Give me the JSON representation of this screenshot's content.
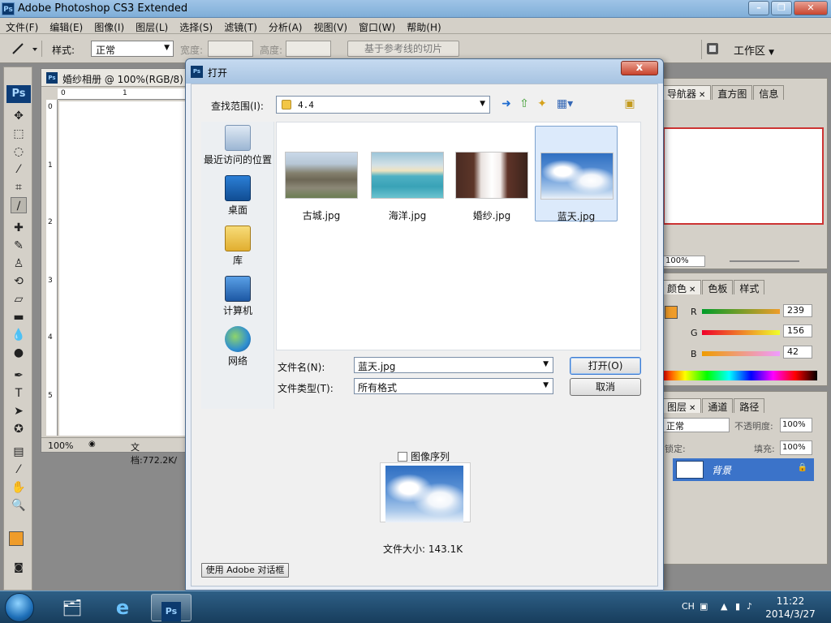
{
  "app": {
    "title": "Adobe Photoshop CS3 Extended",
    "logo": "Ps",
    "window_buttons": [
      "minimize-icon",
      "restore-icon",
      "close-icon"
    ]
  },
  "menu": [
    "文件(F)",
    "编辑(E)",
    "图像(I)",
    "图层(L)",
    "选择(S)",
    "滤镜(T)",
    "分析(A)",
    "视图(V)",
    "窗口(W)",
    "帮助(H)"
  ],
  "options_bar": {
    "style_label": "样式:",
    "style_value": "正常",
    "width_label": "宽度:",
    "height_label": "高度:",
    "slice_button": "基于参考线的切片",
    "workspace_label": "工作区"
  },
  "toolbox": {
    "badge": "Ps",
    "tools": [
      "move-icon",
      "marquee-icon",
      "lasso-icon",
      "magic-wand-icon",
      "crop-icon",
      "slice-icon",
      "healing-brush-icon",
      "brush-icon",
      "clone-stamp-icon",
      "history-brush-icon",
      "eraser-icon",
      "gradient-icon",
      "blur-icon",
      "dodge-icon",
      "pen-icon",
      "type-icon",
      "path-selection-icon",
      "shape-icon",
      "notes-icon",
      "eyedropper-icon",
      "hand-icon",
      "zoom-icon"
    ],
    "type_glyph": "T",
    "foreground_color": "#ef9c2a",
    "background_color": "#ffffff"
  },
  "document": {
    "title": "婚纱相册 @ 100%(RGB/8)",
    "ruler_h": [
      "0",
      "1"
    ],
    "ruler_v": [
      "0",
      "1",
      "2",
      "3",
      "4",
      "5"
    ],
    "zoom": "100%",
    "status": "文档:772.2K/"
  },
  "panels": {
    "navigator": {
      "tabs": [
        "导航器",
        "直方图",
        "信息"
      ],
      "zoom": "100%"
    },
    "color": {
      "tabs": [
        "颜色",
        "色板",
        "样式"
      ],
      "r_label": "R",
      "g_label": "G",
      "b_label": "B",
      "r": "239",
      "g": "156",
      "b": "42"
    },
    "layers": {
      "tabs": [
        "图层",
        "通道",
        "路径"
      ],
      "blend_mode": "正常",
      "opacity_label": "不透明度:",
      "opacity": "100%",
      "lock_label": "锁定:",
      "fill_label": "填充:",
      "fill": "100%",
      "layer_name": "背景"
    }
  },
  "dialog": {
    "title": "打开",
    "logo": "Ps",
    "close_glyph": "x",
    "lookin_label": "查找范围(I):",
    "lookin_value": "4.4",
    "places": [
      "最近访问的位置",
      "桌面",
      "库",
      "计算机",
      "网络"
    ],
    "files": [
      {
        "name": "古城.jpg",
        "selected": false
      },
      {
        "name": "海洋.jpg",
        "selected": false
      },
      {
        "name": "婚纱.jpg",
        "selected": false
      },
      {
        "name": "蓝天.jpg",
        "selected": true
      }
    ],
    "filename_label": "文件名(N):",
    "filename_value": "蓝天.jpg",
    "filetype_label": "文件类型(T):",
    "filetype_value": "所有格式",
    "open_button": "打开(O)",
    "cancel_button": "取消",
    "image_sequence_label": "图像序列",
    "file_size": "文件大小: 143.1K",
    "adobe_dialog_button": "使用 Adobe 对话框"
  },
  "taskbar": {
    "apps": [
      "explorer-icon",
      "ie-icon",
      "photoshop-icon"
    ],
    "photoshop_label": "Ps",
    "language": "CH",
    "time": "11:22",
    "date": "2014/3/27"
  }
}
